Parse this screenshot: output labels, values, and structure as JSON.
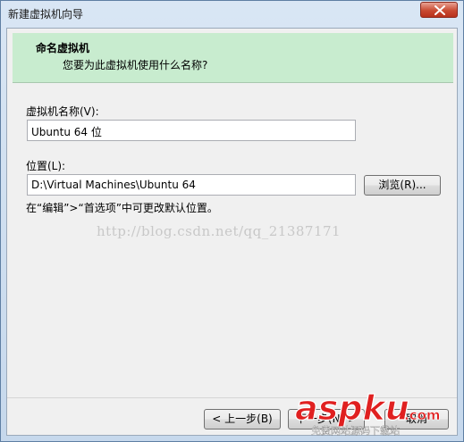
{
  "window": {
    "title": "新建虚拟机向导"
  },
  "banner": {
    "heading": "命名虚拟机",
    "subheading": "您要为此虚拟机使用什么名称?"
  },
  "vm_name": {
    "label": "虚拟机名称(V):",
    "value": "Ubuntu 64 位"
  },
  "location": {
    "label": "位置(L):",
    "value": "D:\\Virtual Machines\\Ubuntu 64",
    "browse_label": "浏览(R)..."
  },
  "hint": "在“编辑”>“首选项”中可更改默认位置。",
  "watermark": "http://blog.csdn.net/qq_21387171",
  "footer": {
    "back_label": "< 上一步(B)",
    "next_label": "下一步(N) >",
    "cancel_label": "取消"
  },
  "stamp": {
    "brand": "aspku",
    "com": ".com",
    "tagline": "免费网站源码下载站"
  },
  "colors": {
    "banner_bg": "#c8eccf",
    "brand_red": "#e02020"
  }
}
